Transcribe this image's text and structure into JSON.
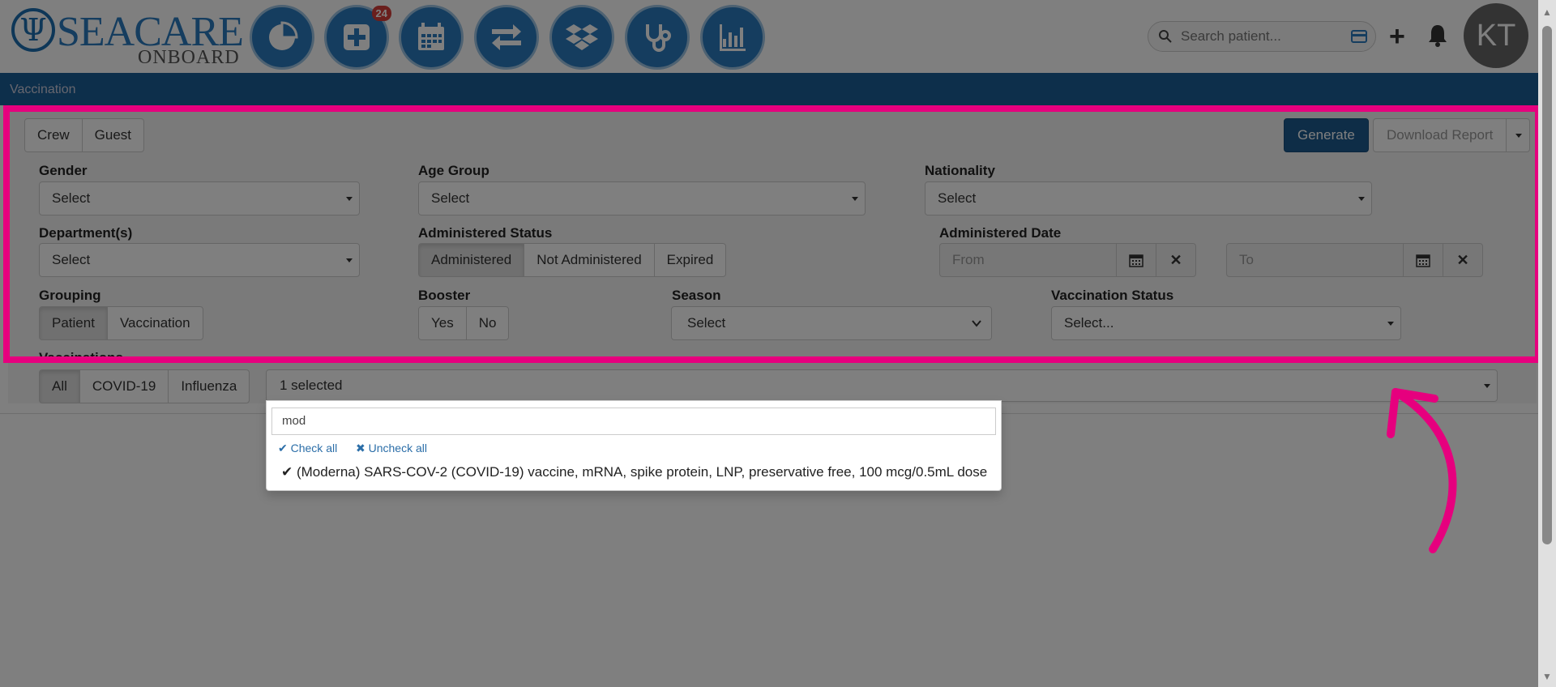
{
  "header": {
    "logo_text": "SEACARE",
    "logo_sub": "ONBOARD",
    "badge_count": "24",
    "search_placeholder": "Search patient...",
    "avatar_initials": "KT"
  },
  "page_title": "Vaccination",
  "patient_type": {
    "crew": "Crew",
    "guest": "Guest"
  },
  "actions": {
    "generate": "Generate",
    "download": "Download Report"
  },
  "filters": {
    "gender": {
      "label": "Gender",
      "value": "Select"
    },
    "age_group": {
      "label": "Age Group",
      "value": "Select"
    },
    "nationality": {
      "label": "Nationality",
      "value": "Select"
    },
    "departments": {
      "label": "Department(s)",
      "value": "Select"
    },
    "administered_status": {
      "label": "Administered Status",
      "options": [
        "Administered",
        "Not Administered",
        "Expired"
      ],
      "selected": "Administered"
    },
    "administered_date": {
      "label": "Administered Date",
      "from_placeholder": "From",
      "to_placeholder": "To"
    },
    "grouping": {
      "label": "Grouping",
      "options": [
        "Patient",
        "Vaccination"
      ],
      "selected": "Patient"
    },
    "booster": {
      "label": "Booster",
      "options": [
        "Yes",
        "No"
      ]
    },
    "season": {
      "label": "Season",
      "value": "Select"
    },
    "vaccination_status": {
      "label": "Vaccination Status",
      "value": "Select..."
    }
  },
  "vaccinations": {
    "label": "Vaccinations",
    "options": [
      "All",
      "COVID-19",
      "Influenza"
    ],
    "selected": "All",
    "multiselect_value": "1 selected",
    "filter_text": "mod",
    "check_all": "Check all",
    "uncheck_all": "Uncheck all",
    "option": "(Moderna) SARS-COV-2 (COVID-19) vaccine, mRNA, spike protein, LNP, preservative free, 100 mcg/0.5mL dose"
  },
  "colors": {
    "brand": "#2b7bbf",
    "titlebar": "#1b5f96",
    "generate": "#1c5a8e",
    "highlight": "#e6007e"
  }
}
